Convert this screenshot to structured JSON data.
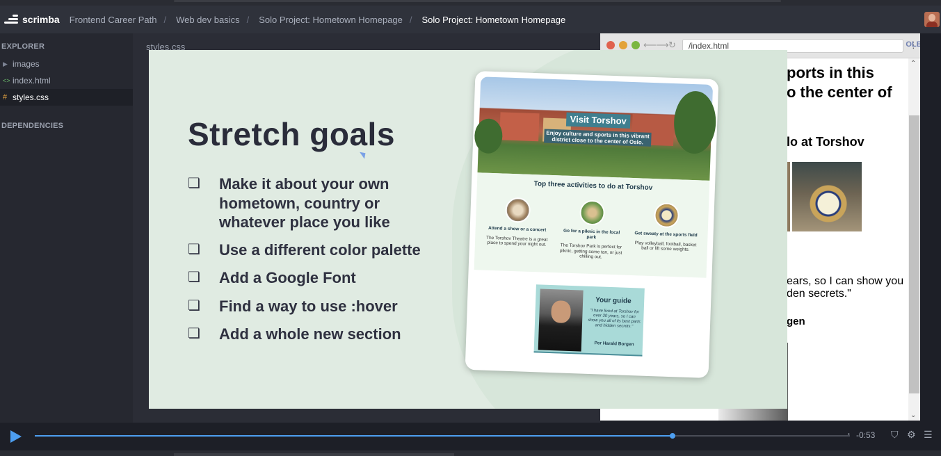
{
  "header": {
    "brand": "scrimba",
    "breadcrumbs": [
      "Frontend Career Path",
      "Web dev basics",
      "Solo Project: Hometown Homepage"
    ],
    "current": "Solo Project: Hometown Homepage",
    "separator": "/"
  },
  "sidebar": {
    "explorer_title": "EXPLORER",
    "items": [
      {
        "icon": "▶",
        "label": "images"
      },
      {
        "icon": "<>",
        "label": "index.html"
      },
      {
        "icon": "#",
        "label": "styles.css"
      }
    ],
    "dependencies_title": "DEPENDENCIES"
  },
  "editor": {
    "tab": "styles.css"
  },
  "preview": {
    "address": "/index.html",
    "console_label": "OLE",
    "text_line1": "ports in this",
    "text_line2": "o the center of",
    "subheading": "lo at Torshov",
    "para_line1": "ears, so I can show you",
    "para_line2": "den secrets.\"",
    "name_partial": "gen"
  },
  "slide": {
    "title": "Stretch goals",
    "checkbox_glyph": "❏",
    "goals": [
      "Make it about your own hometown, country or whatever place you like",
      "Use a different color palette",
      "Add a Google Font",
      "Find a way to use :hover",
      "Add a whole new section"
    ],
    "mockup": {
      "hero_title": "Visit Torshov",
      "hero_subtitle": "Enjoy culture and sports in this vibrant district close to the center of Oslo.",
      "activities_title": "Top three activities to do at Torshov",
      "activities": [
        {
          "heading": "Attend a show or a concert",
          "text": "The Torshov Theatre is a great place to spend your night out."
        },
        {
          "heading": "Go for a piknic in the local park",
          "text": "The Torshov Park is perfect for piknic, getting some tan, or just chilling out."
        },
        {
          "heading": "Get sweaty at the sports field",
          "text": "Play volleyball, football, basket ball or lift some weights."
        }
      ],
      "guide_heading": "Your guide",
      "guide_quote": "\"I have lived at Torshov for over 30 years, so I can show you all of its best parts and hidden secrets.\"",
      "guide_name": "Per Harald Borgen"
    }
  },
  "player": {
    "time_remaining": "-0:53",
    "progress": 0.782
  },
  "colors": {
    "accent": "#4d9ef0",
    "slide_bg": "#e0ebe2",
    "sidebar_bg": "#262830"
  }
}
